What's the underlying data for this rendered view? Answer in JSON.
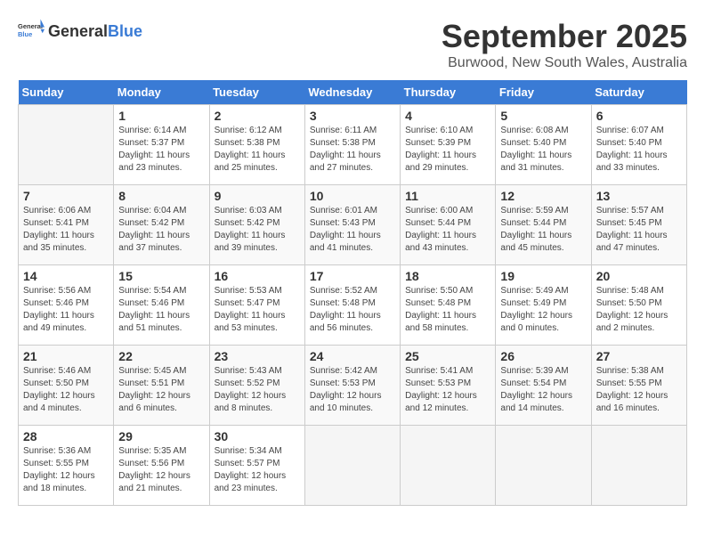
{
  "header": {
    "logo_general": "General",
    "logo_blue": "Blue",
    "month": "September 2025",
    "location": "Burwood, New South Wales, Australia"
  },
  "days_of_week": [
    "Sunday",
    "Monday",
    "Tuesday",
    "Wednesday",
    "Thursday",
    "Friday",
    "Saturday"
  ],
  "weeks": [
    [
      {
        "day": "",
        "info": ""
      },
      {
        "day": "1",
        "info": "Sunrise: 6:14 AM\nSunset: 5:37 PM\nDaylight: 11 hours\nand 23 minutes."
      },
      {
        "day": "2",
        "info": "Sunrise: 6:12 AM\nSunset: 5:38 PM\nDaylight: 11 hours\nand 25 minutes."
      },
      {
        "day": "3",
        "info": "Sunrise: 6:11 AM\nSunset: 5:38 PM\nDaylight: 11 hours\nand 27 minutes."
      },
      {
        "day": "4",
        "info": "Sunrise: 6:10 AM\nSunset: 5:39 PM\nDaylight: 11 hours\nand 29 minutes."
      },
      {
        "day": "5",
        "info": "Sunrise: 6:08 AM\nSunset: 5:40 PM\nDaylight: 11 hours\nand 31 minutes."
      },
      {
        "day": "6",
        "info": "Sunrise: 6:07 AM\nSunset: 5:40 PM\nDaylight: 11 hours\nand 33 minutes."
      }
    ],
    [
      {
        "day": "7",
        "info": "Sunrise: 6:06 AM\nSunset: 5:41 PM\nDaylight: 11 hours\nand 35 minutes."
      },
      {
        "day": "8",
        "info": "Sunrise: 6:04 AM\nSunset: 5:42 PM\nDaylight: 11 hours\nand 37 minutes."
      },
      {
        "day": "9",
        "info": "Sunrise: 6:03 AM\nSunset: 5:42 PM\nDaylight: 11 hours\nand 39 minutes."
      },
      {
        "day": "10",
        "info": "Sunrise: 6:01 AM\nSunset: 5:43 PM\nDaylight: 11 hours\nand 41 minutes."
      },
      {
        "day": "11",
        "info": "Sunrise: 6:00 AM\nSunset: 5:44 PM\nDaylight: 11 hours\nand 43 minutes."
      },
      {
        "day": "12",
        "info": "Sunrise: 5:59 AM\nSunset: 5:44 PM\nDaylight: 11 hours\nand 45 minutes."
      },
      {
        "day": "13",
        "info": "Sunrise: 5:57 AM\nSunset: 5:45 PM\nDaylight: 11 hours\nand 47 minutes."
      }
    ],
    [
      {
        "day": "14",
        "info": "Sunrise: 5:56 AM\nSunset: 5:46 PM\nDaylight: 11 hours\nand 49 minutes."
      },
      {
        "day": "15",
        "info": "Sunrise: 5:54 AM\nSunset: 5:46 PM\nDaylight: 11 hours\nand 51 minutes."
      },
      {
        "day": "16",
        "info": "Sunrise: 5:53 AM\nSunset: 5:47 PM\nDaylight: 11 hours\nand 53 minutes."
      },
      {
        "day": "17",
        "info": "Sunrise: 5:52 AM\nSunset: 5:48 PM\nDaylight: 11 hours\nand 56 minutes."
      },
      {
        "day": "18",
        "info": "Sunrise: 5:50 AM\nSunset: 5:48 PM\nDaylight: 11 hours\nand 58 minutes."
      },
      {
        "day": "19",
        "info": "Sunrise: 5:49 AM\nSunset: 5:49 PM\nDaylight: 12 hours\nand 0 minutes."
      },
      {
        "day": "20",
        "info": "Sunrise: 5:48 AM\nSunset: 5:50 PM\nDaylight: 12 hours\nand 2 minutes."
      }
    ],
    [
      {
        "day": "21",
        "info": "Sunrise: 5:46 AM\nSunset: 5:50 PM\nDaylight: 12 hours\nand 4 minutes."
      },
      {
        "day": "22",
        "info": "Sunrise: 5:45 AM\nSunset: 5:51 PM\nDaylight: 12 hours\nand 6 minutes."
      },
      {
        "day": "23",
        "info": "Sunrise: 5:43 AM\nSunset: 5:52 PM\nDaylight: 12 hours\nand 8 minutes."
      },
      {
        "day": "24",
        "info": "Sunrise: 5:42 AM\nSunset: 5:53 PM\nDaylight: 12 hours\nand 10 minutes."
      },
      {
        "day": "25",
        "info": "Sunrise: 5:41 AM\nSunset: 5:53 PM\nDaylight: 12 hours\nand 12 minutes."
      },
      {
        "day": "26",
        "info": "Sunrise: 5:39 AM\nSunset: 5:54 PM\nDaylight: 12 hours\nand 14 minutes."
      },
      {
        "day": "27",
        "info": "Sunrise: 5:38 AM\nSunset: 5:55 PM\nDaylight: 12 hours\nand 16 minutes."
      }
    ],
    [
      {
        "day": "28",
        "info": "Sunrise: 5:36 AM\nSunset: 5:55 PM\nDaylight: 12 hours\nand 18 minutes."
      },
      {
        "day": "29",
        "info": "Sunrise: 5:35 AM\nSunset: 5:56 PM\nDaylight: 12 hours\nand 21 minutes."
      },
      {
        "day": "30",
        "info": "Sunrise: 5:34 AM\nSunset: 5:57 PM\nDaylight: 12 hours\nand 23 minutes."
      },
      {
        "day": "",
        "info": ""
      },
      {
        "day": "",
        "info": ""
      },
      {
        "day": "",
        "info": ""
      },
      {
        "day": "",
        "info": ""
      }
    ]
  ]
}
